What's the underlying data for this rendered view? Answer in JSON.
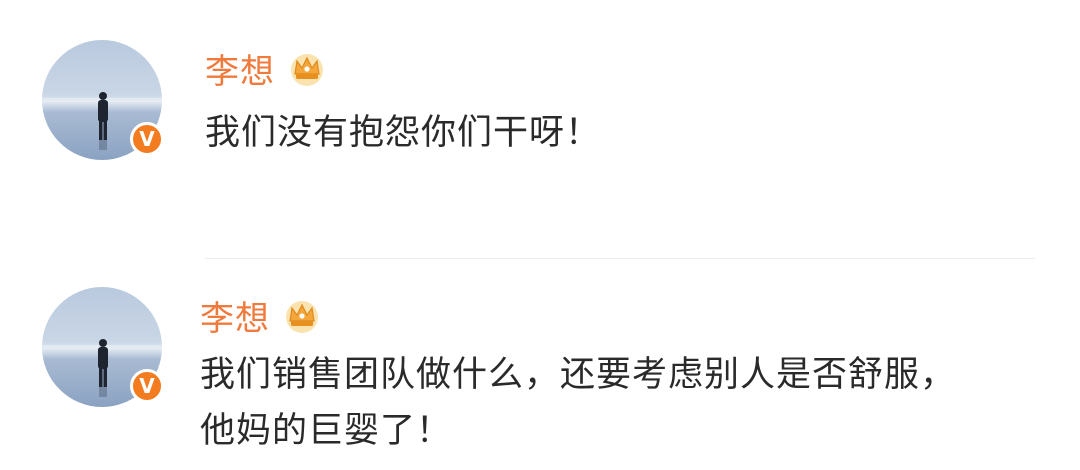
{
  "comments": [
    {
      "username": "李想",
      "verified_mark": "V",
      "badge_icon": "crown-badge-icon",
      "text_lines": [
        "我们没有抱怨你们干呀！"
      ]
    },
    {
      "username": "李想",
      "verified_mark": "V",
      "badge_icon": "crown-badge-icon",
      "text_lines": [
        "我们销售团队做什么，还要考虑别人是否舒服，",
        "他妈的巨婴了！"
      ]
    }
  ],
  "colors": {
    "username": "#f07a3b",
    "verified_badge": "#f27c1f",
    "body_text": "#2a2a2a",
    "divider": "#ececec"
  }
}
